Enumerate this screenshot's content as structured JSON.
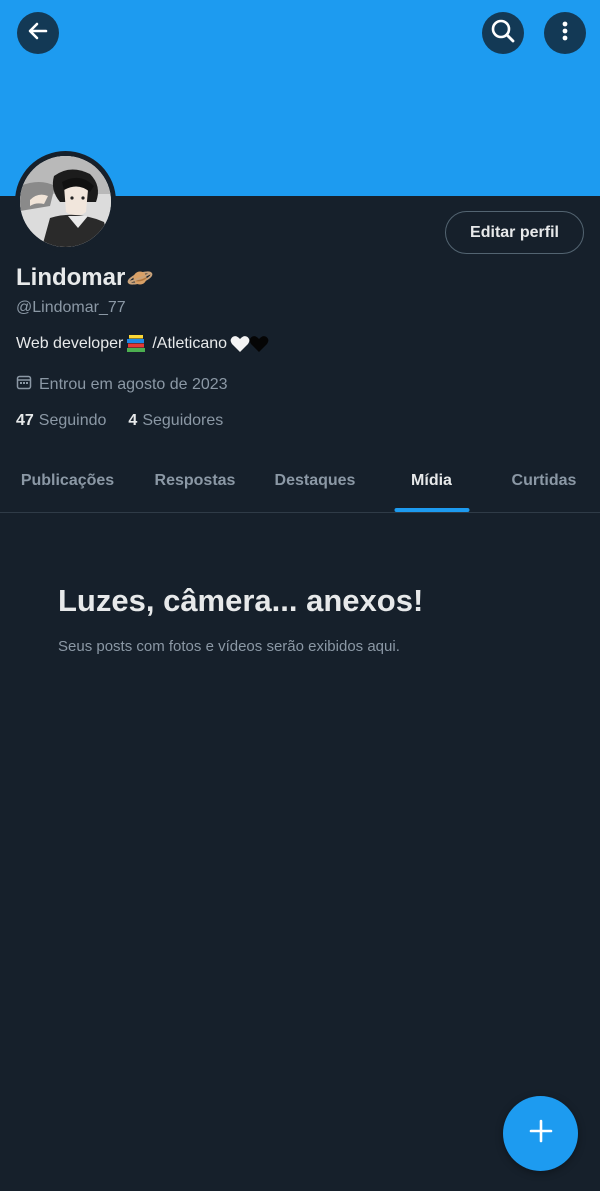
{
  "header": {
    "back_icon": "arrow-left-icon",
    "search_icon": "search-icon",
    "more_icon": "more-vertical-icon",
    "banner_color": "#1d9bf0"
  },
  "profile": {
    "avatar": "avatar-anime-character",
    "edit_label": "Editar perfil",
    "display_name": "Lindomar",
    "name_emoji_icon": "ringed-planet-icon",
    "handle": "@Lindomar_77",
    "bio": {
      "part1": "Web developer",
      "books_icon": "books-icon",
      "part2": "/Atleticano",
      "hearts_icons": [
        "white-heart-icon",
        "black-heart-icon"
      ]
    },
    "joined_icon": "calendar-icon",
    "joined": "Entrou em agosto de 2023",
    "following_count": "47",
    "following_label": "Seguindo",
    "followers_count": "4",
    "followers_label": "Seguidores"
  },
  "tabs": [
    {
      "label": "Publicações",
      "active": false
    },
    {
      "label": "Respostas",
      "active": false
    },
    {
      "label": "Destaques",
      "active": false
    },
    {
      "label": "Mídia",
      "active": true
    },
    {
      "label": "Curtidas",
      "active": false
    }
  ],
  "empty_state": {
    "title": "Luzes, câmera... anexos!",
    "subtitle": "Seus posts com fotos e vídeos serão exibidos aqui."
  },
  "fab": {
    "icon": "plus-icon"
  },
  "colors": {
    "accent": "#1d9bf0",
    "background": "#16202b",
    "text_primary": "#e7e9ea",
    "text_secondary": "#8b98a5"
  }
}
